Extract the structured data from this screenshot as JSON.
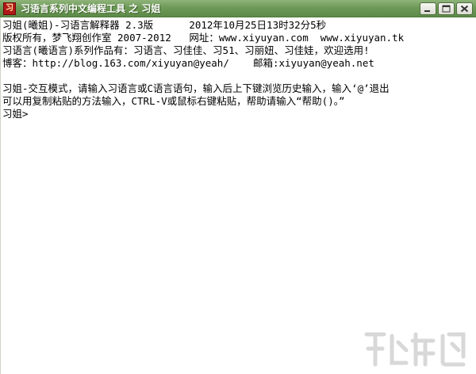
{
  "window": {
    "title": "习语言系列中文编程工具 之 习姐",
    "icon_name": "app-icon",
    "icon_glyph": "习",
    "accent_color": "#6e9a58"
  },
  "controls": {
    "minimize": "minimize-icon",
    "maximize": "maximize-icon",
    "close": "close-icon"
  },
  "console": {
    "lines": [
      "习姐(曦姐)-习语言解释器 2.3版      2012年10月25日13时32分5秒",
      "版权所有，梦飞翔创作室 2007-2012   网址：www.xiyuyan.com  www.xiyuyan.tk",
      "习语言(曦语言)系列作品有：习语言、习佳佳、习51、习丽妞、习佳娃，欢迎选用!",
      "博客：http://blog.163.com/xiyuyan@yeah/    邮箱:xiyuyan@yeah.net",
      "",
      "习姐-交互模式，请输入习语言或C语言语句，输入后上下键浏览历史输入，输入‘@’退出",
      "可以用复制粘贴的方法输入，CTRL-V或鼠标右键粘贴，帮助请输入“帮助()。”",
      "习姐>"
    ]
  },
  "watermark": {
    "icon_name": "site-watermark-logo"
  }
}
